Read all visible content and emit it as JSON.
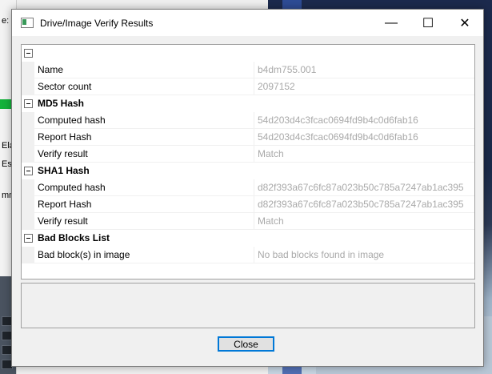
{
  "background": {
    "fragments": [
      "e:",
      "Ela",
      "Es",
      "mma"
    ]
  },
  "dialog": {
    "title": "Drive/Image Verify Results",
    "controls": {
      "minimize": "—",
      "maximize": "☐",
      "close": "✕"
    },
    "root_toggle": "−",
    "rows": [
      {
        "kind": "prop",
        "name": "Name",
        "value": "b4dm755.001"
      },
      {
        "kind": "prop",
        "name": "Sector count",
        "value": "2097152"
      },
      {
        "kind": "cat",
        "title": "MD5 Hash"
      },
      {
        "kind": "prop",
        "name": "Computed hash",
        "value": "54d203d4c3fcac0694fd9b4c0d6fab16"
      },
      {
        "kind": "prop",
        "name": "Report Hash",
        "value": "54d203d4c3fcac0694fd9b4c0d6fab16"
      },
      {
        "kind": "prop",
        "name": "Verify result",
        "value": "Match"
      },
      {
        "kind": "cat",
        "title": "SHA1 Hash"
      },
      {
        "kind": "prop",
        "name": "Computed hash",
        "value": "d82f393a67c6fc87a023b50c785a7247ab1ac395"
      },
      {
        "kind": "prop",
        "name": "Report Hash",
        "value": "d82f393a67c6fc87a023b50c785a7247ab1ac395"
      },
      {
        "kind": "prop",
        "name": "Verify result",
        "value": "Match"
      },
      {
        "kind": "cat",
        "title": "Bad Blocks List"
      },
      {
        "kind": "prop",
        "name": "Bad block(s) in image",
        "value": "No bad blocks found in image"
      }
    ],
    "close_label": "Close"
  }
}
